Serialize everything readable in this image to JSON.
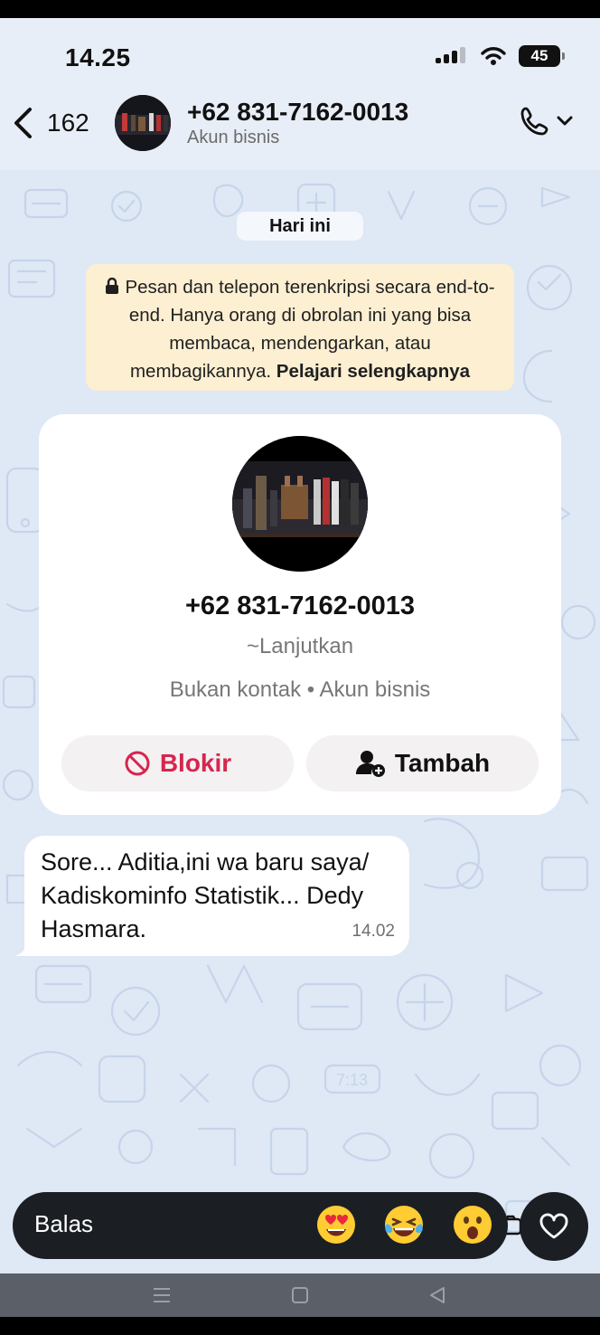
{
  "status": {
    "time": "14.25",
    "battery": "45"
  },
  "header": {
    "back_count": "162",
    "contact_name": "+62 831-7162-0013",
    "contact_sub": "Akun bisnis"
  },
  "chat": {
    "date_label": "Hari ini",
    "encryption_text": "Pesan dan telepon terenkripsi secara end-to-end. Hanya orang di obrolan ini yang bisa membaca, mendengarkan, atau membagikannya.",
    "encryption_link": "Pelajari selengkapnya"
  },
  "contact_card": {
    "phone": "+62 831-7162-0013",
    "nickname": "~Lanjutkan",
    "meta": "Bukan kontak • Akun bisnis",
    "block_label": "Blokir",
    "add_label": "Tambah"
  },
  "message": {
    "line1": "Sore... Aditia,ini wa baru saya/",
    "line2": "Kadiskominfo Statistik... Dedy",
    "line3": "Hasmara.",
    "time": "14.02"
  },
  "composer": {
    "placeholder": "Balas",
    "reactions": [
      "heart-eyes-emoji",
      "tears-of-joy-emoji",
      "surprised-emoji"
    ]
  },
  "colors": {
    "accent_red": "#d6254f",
    "bubble_bg": "#ffffff",
    "notice_bg": "#fcefd2",
    "wallpaper": "#dfe8f5"
  }
}
